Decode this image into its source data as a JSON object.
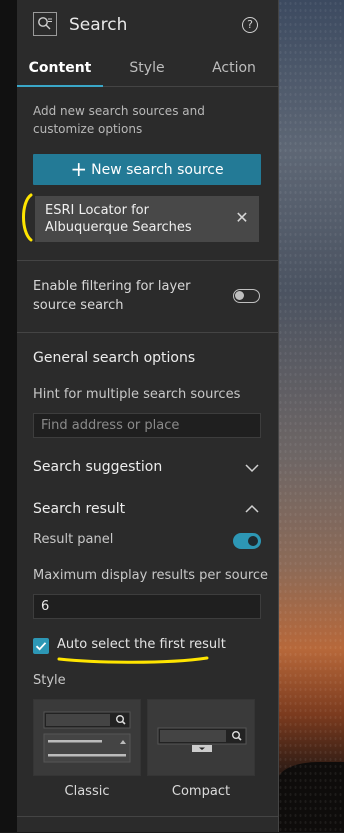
{
  "header": {
    "title": "Search",
    "help": "?"
  },
  "tabs": [
    {
      "label": "Content",
      "active": true
    },
    {
      "label": "Style",
      "active": false
    },
    {
      "label": "Action",
      "active": false
    }
  ],
  "content": {
    "description": "Add new search sources and customize options",
    "new_source_button": "New search source",
    "sources": [
      {
        "label": "ESRI Locator for Albuquerque Searches"
      }
    ],
    "filtering_label": "Enable filtering for layer source search",
    "filtering_enabled": false
  },
  "general": {
    "heading": "General search options",
    "hint_label": "Hint for multiple search sources",
    "hint_placeholder": "Find address or place",
    "suggestion_label": "Search suggestion",
    "result_label": "Search result",
    "result_panel_label": "Result panel",
    "result_panel_enabled": true,
    "max_results_label": "Maximum display results per source",
    "max_results_value": "6",
    "auto_select_label": "Auto select the first result",
    "auto_select_checked": true,
    "style_label": "Style",
    "styles": [
      {
        "label": "Classic"
      },
      {
        "label": "Compact"
      }
    ]
  },
  "colors": {
    "accent": "#2d97b5",
    "button": "#237a96",
    "annotation": "#ffe500"
  }
}
